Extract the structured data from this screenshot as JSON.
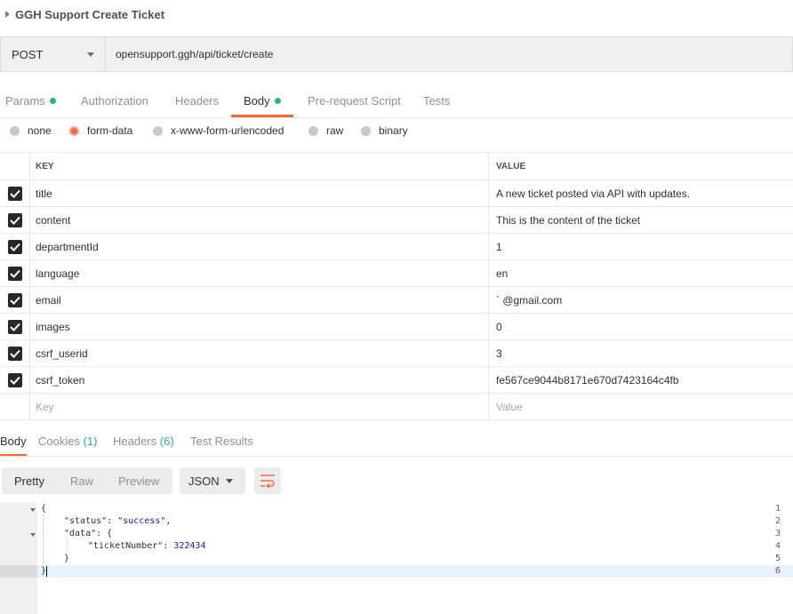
{
  "request": {
    "name": "GGH Support Create Ticket",
    "method": "POST",
    "url": "opensupport.ggh/api/ticket/create"
  },
  "request_tabs": [
    {
      "label": "Params",
      "dot": true,
      "active": false
    },
    {
      "label": "Authorization",
      "dot": false,
      "active": false
    },
    {
      "label": "Headers",
      "dot": false,
      "active": false
    },
    {
      "label": "Body",
      "dot": true,
      "active": true
    },
    {
      "label": "Pre-request Script",
      "dot": false,
      "active": false
    },
    {
      "label": "Tests",
      "dot": false,
      "active": false
    }
  ],
  "body_types": [
    {
      "label": "none",
      "selected": false
    },
    {
      "label": "form-data",
      "selected": true
    },
    {
      "label": "x-www-form-urlencoded",
      "selected": false
    },
    {
      "label": "raw",
      "selected": false
    },
    {
      "label": "binary",
      "selected": false
    }
  ],
  "form_table": {
    "headers": {
      "key": "KEY",
      "value": "VALUE"
    },
    "rows": [
      {
        "checked": true,
        "key": "title",
        "value": "A new ticket posted via API with updates."
      },
      {
        "checked": true,
        "key": "content",
        "value": "This is the content of the ticket"
      },
      {
        "checked": true,
        "key": "departmentId",
        "value": "1"
      },
      {
        "checked": true,
        "key": "language",
        "value": "en"
      },
      {
        "checked": true,
        "key": "email",
        "value": "`          @gmail.com"
      },
      {
        "checked": true,
        "key": "images",
        "value": "0"
      },
      {
        "checked": true,
        "key": "csrf_userid",
        "value": "3"
      },
      {
        "checked": true,
        "key": "csrf_token",
        "value": "fe567ce9044b8171e670d7423164c4fb"
      }
    ],
    "new_row": {
      "key_placeholder": "Key",
      "value_placeholder": "Value"
    }
  },
  "response_tabs": [
    {
      "label": "Body",
      "active": true
    },
    {
      "label": "Cookies",
      "count": "(1)",
      "active": false
    },
    {
      "label": "Headers",
      "count": "(6)",
      "active": false
    },
    {
      "label": "Test Results",
      "active": false
    }
  ],
  "view_modes": [
    "Pretty",
    "Raw",
    "Preview"
  ],
  "active_view_mode": "Pretty",
  "format": "JSON",
  "wrap_icon": "wrap-lines-icon",
  "response_lines": [
    {
      "num": "1",
      "text": "{"
    },
    {
      "num": "2",
      "key": "\"status\"",
      "value": "\"success\""
    },
    {
      "num": "3",
      "key": "\"data\"",
      "text": "{"
    },
    {
      "num": "4",
      "key": "\"ticketNumber\"",
      "value": "322434"
    },
    {
      "num": "5",
      "text": "}"
    },
    {
      "num": "6",
      "text": "}"
    }
  ],
  "colors": {
    "accent": "#f26b3a",
    "dot_green": "#26b47f",
    "json_value": "#1a1aa6"
  }
}
